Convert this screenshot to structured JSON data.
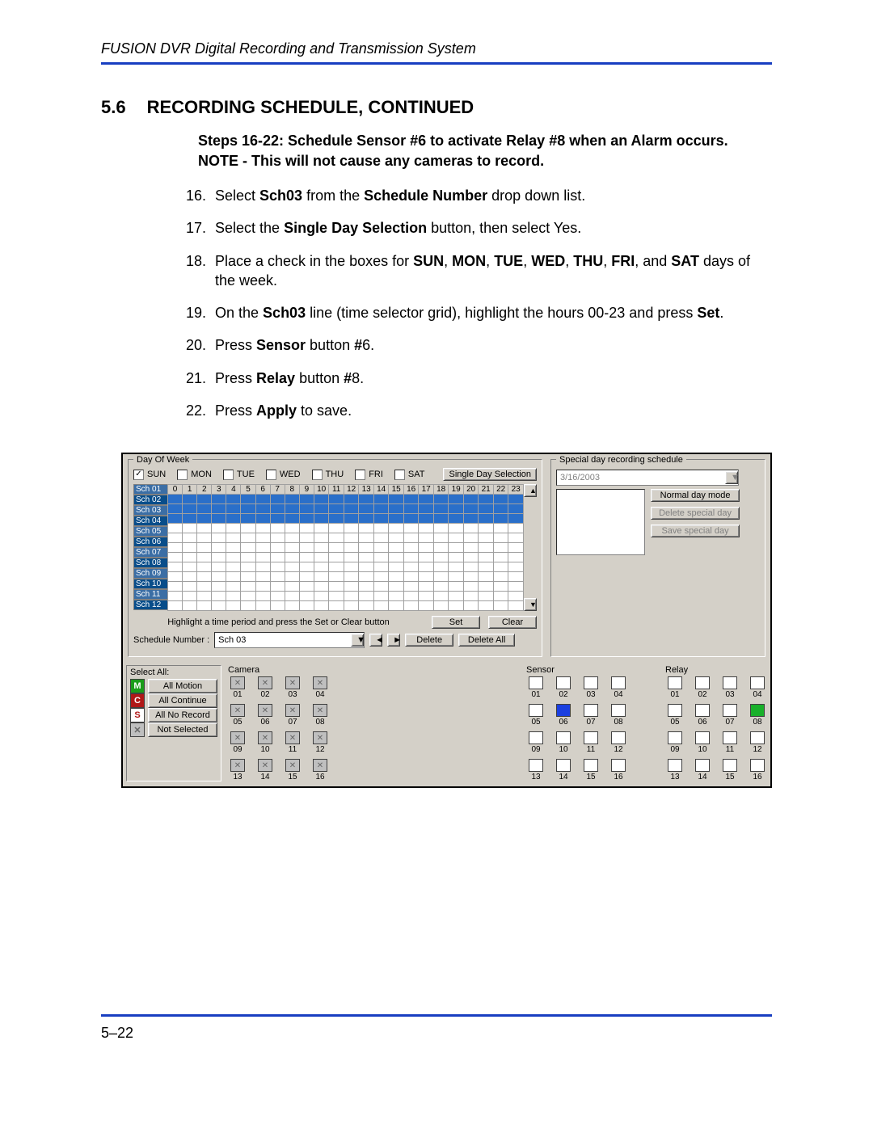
{
  "header": {
    "title": "FUSION DVR Digital Recording and Transmission System"
  },
  "section": {
    "number": "5.6",
    "title": "RECORDING SCHEDULE, CONTINUED"
  },
  "subhead": "Steps 16-22: Schedule Sensor #6 to activate Relay #8 when an Alarm occurs.",
  "note": "NOTE - This will not cause any cameras to record.",
  "steps_start": 16,
  "steps": [
    "Select <b>Sch03</b> from the <b>Schedule Number</b> drop down list.",
    "Select the <b>Single Day Selection</b> button, then select Yes.",
    "Place a check in the boxes for <b>SUN</b>, <b>MON</b>, <b>TUE</b>, <b>WED</b>, <b>THU</b>, <b>FRI</b>, and <b>SAT</b> days of the week.",
    "On the <b>Sch03</b> line (time selector grid), highlight the hours 00-23 and press <b>Set</b>.",
    "Press <b>Sensor</b> button <b>#</b>6.",
    "Press <b>Relay</b> button <b>#</b>8.",
    "Press <b>Apply</b> to save."
  ],
  "panel": {
    "dow_legend": "Day Of Week",
    "days": [
      "SUN",
      "MON",
      "TUE",
      "WED",
      "THU",
      "FRI",
      "SAT"
    ],
    "sun_checked": true,
    "single_day_btn": "Single Day Selection",
    "spec_legend": "Special day recording schedule",
    "spec_date": "3/16/2003",
    "normal_btn": "Normal day mode",
    "delete_spec_btn": "Delete special day",
    "save_spec_btn": "Save special day",
    "hours": [
      "0",
      "1",
      "2",
      "3",
      "4",
      "5",
      "6",
      "7",
      "8",
      "9",
      "10",
      "11",
      "12",
      "13",
      "14",
      "15",
      "16",
      "17",
      "18",
      "19",
      "20",
      "21",
      "22",
      "23"
    ],
    "sch_rows": [
      "Sch 01",
      "Sch 02",
      "Sch 03",
      "Sch 04",
      "Sch 05",
      "Sch 06",
      "Sch 07",
      "Sch 08",
      "Sch 09",
      "Sch 10",
      "Sch 11",
      "Sch 12"
    ],
    "filled_rows": [
      0,
      1,
      2
    ],
    "hint": "Highlight a time period and press the Set or Clear button",
    "set_btn": "Set",
    "clear_btn": "Clear",
    "sched_num_label": "Schedule Number :",
    "sched_num_value": "Sch 03",
    "delete_btn": "Delete",
    "delete_all_btn": "Delete All",
    "select_all": {
      "title": "Select All:",
      "motion": "All Motion",
      "continue": "All Continue",
      "norecord": "All No Record",
      "notsel": "Not Selected"
    },
    "camera_title": "Camera",
    "camera_ids": [
      "01",
      "02",
      "03",
      "04",
      "05",
      "06",
      "07",
      "08",
      "09",
      "10",
      "11",
      "12",
      "13",
      "14",
      "15",
      "16"
    ],
    "sensor_title": "Sensor",
    "sensor_ids": [
      "01",
      "02",
      "03",
      "04",
      "05",
      "06",
      "07",
      "08",
      "09",
      "10",
      "11",
      "12",
      "13",
      "14",
      "15",
      "16"
    ],
    "sensor_on": "06",
    "relay_title": "Relay",
    "relay_ids": [
      "01",
      "02",
      "03",
      "04",
      "05",
      "06",
      "07",
      "08",
      "09",
      "10",
      "11",
      "12",
      "13",
      "14",
      "15",
      "16"
    ],
    "relay_on": "08"
  },
  "pagenum": "5–22"
}
